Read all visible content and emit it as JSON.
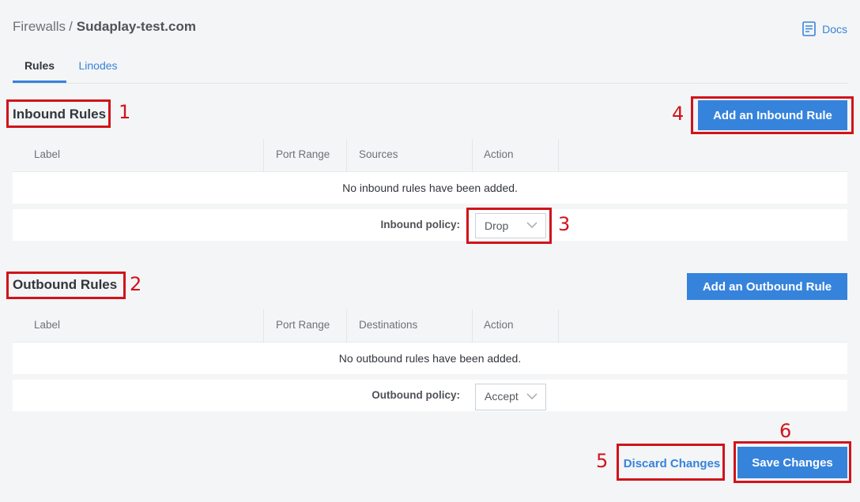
{
  "breadcrumb": {
    "parent": "Firewalls",
    "separator": "/",
    "current": "Sudaplay-test.com"
  },
  "docs": {
    "label": "Docs",
    "icon": "document-icon"
  },
  "tabs": [
    {
      "label": "Rules",
      "active": true
    },
    {
      "label": "Linodes",
      "active": false
    }
  ],
  "inbound": {
    "title": "Inbound Rules",
    "add_button": "Add an Inbound Rule",
    "columns": [
      "Label",
      "Port Range",
      "Sources",
      "Action"
    ],
    "empty_message": "No inbound rules have been added.",
    "policy_label": "Inbound policy:",
    "policy_value": "Drop"
  },
  "outbound": {
    "title": "Outbound Rules",
    "add_button": "Add an Outbound Rule",
    "columns": [
      "Label",
      "Port Range",
      "Destinations",
      "Action"
    ],
    "empty_message": "No outbound rules have been added.",
    "policy_label": "Outbound policy:",
    "policy_value": "Accept"
  },
  "footer": {
    "discard_label": "Discard Changes",
    "save_label": "Save Changes"
  },
  "annotations": [
    "1",
    "2",
    "3",
    "4",
    "5",
    "6"
  ],
  "colors": {
    "accent": "#3683dc",
    "annotation": "#d0141a",
    "background": "#f4f5f6"
  }
}
